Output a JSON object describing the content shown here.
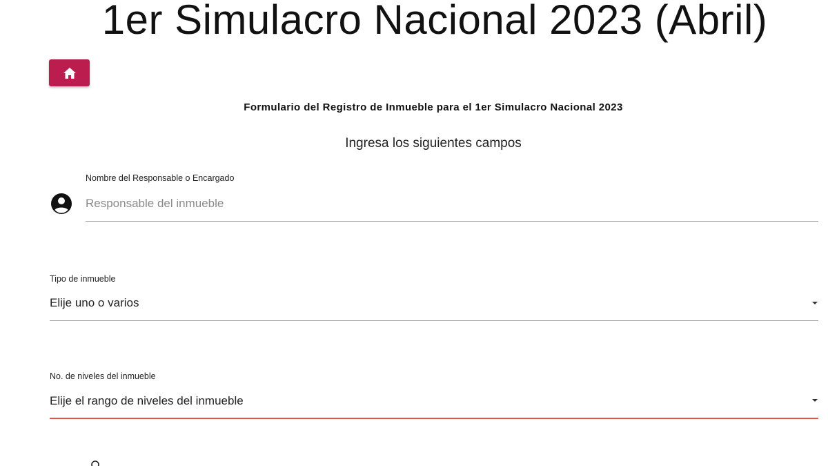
{
  "banner": {
    "title": "1er Simulacro Nacional 2023 (Abril)"
  },
  "toolbar": {
    "home_icon": "home-icon",
    "home_color": "#bc1d4f"
  },
  "form": {
    "title": "Formulario del Registro de Inmueble para el 1er Simulacro Nacional 2023",
    "subtitle": "Ingresa los siguientes campos",
    "fields": {
      "responsable": {
        "label": "Nombre del Responsable o Encargado",
        "placeholder": "Responsable del inmueble",
        "value": "",
        "icon": "person-circle-icon"
      },
      "tipo": {
        "label": "Tipo de inmueble",
        "value": "Elije uno o varios"
      },
      "niveles": {
        "label": "No. de niveles del inmueble",
        "value": "Elije el rango de niveles del inmueble",
        "status_color": "#e0553f"
      }
    }
  },
  "colors": {
    "accent": "#bc1d4f",
    "error": "#e0553f",
    "underline": "#9e9e9e"
  }
}
